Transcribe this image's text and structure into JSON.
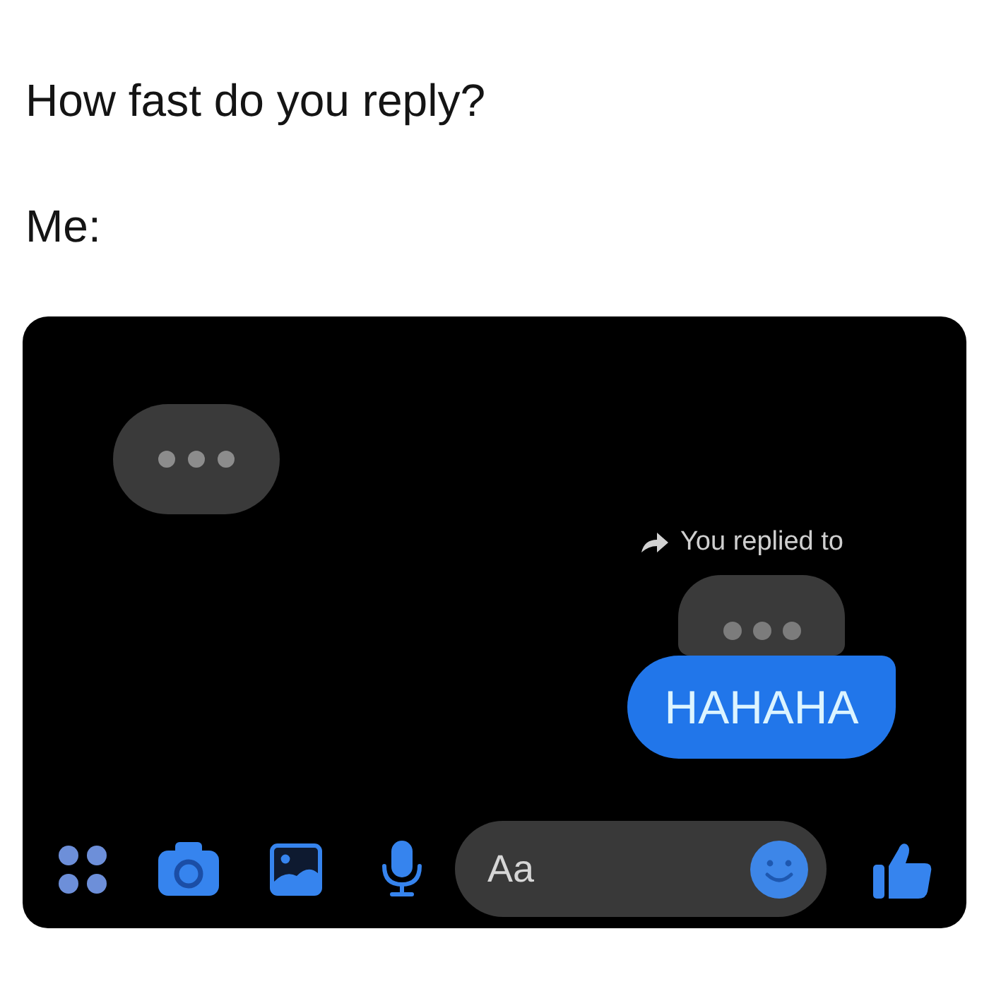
{
  "caption": {
    "question": "How fast do you reply?",
    "answer": "Me:"
  },
  "chat": {
    "items": [
      {
        "kind": "typing"
      },
      {
        "kind": "reply_note",
        "text": "You replied to"
      },
      {
        "kind": "quoted_typing"
      },
      {
        "kind": "sent",
        "text": "HAHAHA"
      }
    ]
  },
  "composer": {
    "placeholder": "Aa"
  }
}
